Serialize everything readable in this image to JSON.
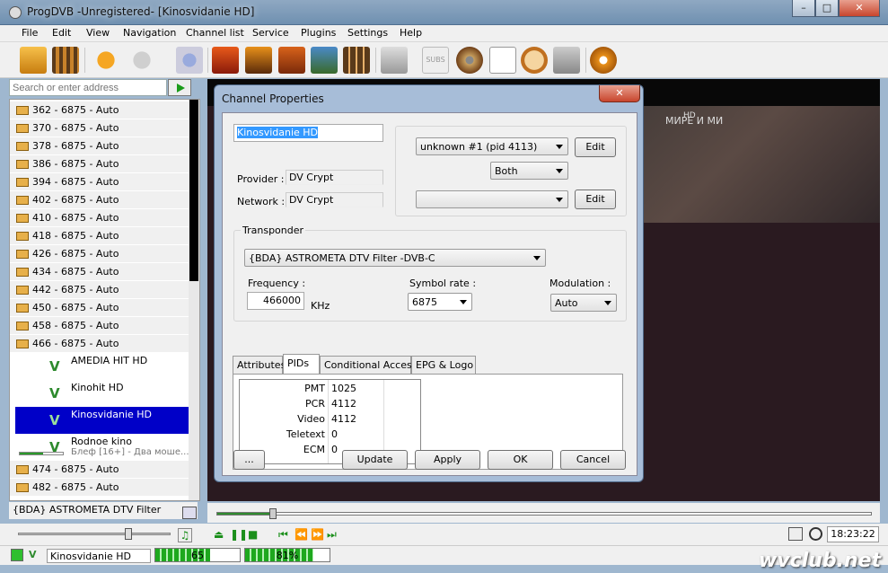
{
  "window": {
    "title": "ProgDVB -Unregistered-  [Kinosvidanie HD]",
    "controls": [
      "–",
      "□",
      "✕"
    ]
  },
  "menu": [
    "File",
    "Edit",
    "View",
    "Navigation",
    "Channel list",
    "Service",
    "Plugins",
    "Settings",
    "Help"
  ],
  "toolbar": {
    "icons": [
      "folder-open-icon",
      "film-icon",
      "back-arrow-icon",
      "forward-arrow-icon",
      "scan-icon",
      "monitor-icon",
      "monitor-pip-icon",
      "3d-icon",
      "picture-icon",
      "grid-icon",
      "record-icon",
      "subs-icon",
      "disc-icon",
      "notes-icon",
      "timer-icon",
      "window-icon",
      "gear-icon"
    ],
    "subs_label": "SUBS"
  },
  "address": {
    "placeholder": "Search or enter address"
  },
  "channel_list": {
    "groups_top": [
      "362 - 6875 - Auto",
      "370 - 6875 - Auto",
      "378 - 6875 - Auto",
      "386 - 6875 - Auto",
      "394 - 6875 - Auto",
      "402 - 6875 - Auto",
      "410 - 6875 - Auto",
      "418 - 6875 - Auto",
      "426 - 6875 - Auto",
      "434 - 6875 - Auto",
      "442 - 6875 - Auto",
      "450 - 6875 - Auto",
      "458 - 6875 - Auto",
      "466 - 6875 - Auto"
    ],
    "channels": [
      {
        "name": "AMEDIA HIT HD",
        "sub": ""
      },
      {
        "name": "Kinohit HD",
        "sub": ""
      },
      {
        "name": "Kinosvidanie HD",
        "sub": "",
        "selected": true
      },
      {
        "name": "Rodnoe kino",
        "sub": "Блеф [16+] - Два моше...",
        "progress": 0.55
      }
    ],
    "groups_bottom": [
      "474 - 6875 - Auto",
      "482 - 6875 - Auto"
    ],
    "device": "{BDA} ASTROMETA DTV Filter"
  },
  "video": {
    "overlay": "МИРЕ И МИ",
    "badge": "HD"
  },
  "dialog": {
    "title": "Channel Properties",
    "close": "✕",
    "name_value": "Kinosvidanie HD",
    "provider_label": "Provider :",
    "provider_value": "DV Crypt",
    "network_label": "Network :",
    "network_value": "DV Crypt",
    "audio_combo": "unknown #1 (pid 4113)",
    "channels_combo": "Both",
    "second_combo": "",
    "edit1": "Edit",
    "edit2": "Edit",
    "transponder_label": "Transponder",
    "transponder_combo": "{BDA} ASTROMETA DTV Filter -DVB-C",
    "frequency_label": "Frequency :",
    "frequency_value": "466000",
    "frequency_unit": "KHz",
    "symbol_label": "Symbol rate :",
    "symbol_value": "6875",
    "modulation_label": "Modulation :",
    "modulation_value": "Auto",
    "tabs": [
      "Attributes",
      "PIDs",
      "Conditional Access",
      "EPG & Logo"
    ],
    "active_tab": "PIDs",
    "pids": [
      {
        "k": "PMT",
        "v": "1025"
      },
      {
        "k": "PCR",
        "v": "4112"
      },
      {
        "k": "Video",
        "v": "4112"
      },
      {
        "k": "Teletext",
        "v": "0"
      },
      {
        "k": "ECM",
        "v": "0"
      }
    ],
    "buttons": {
      "more": "...",
      "update": "Update",
      "apply": "Apply",
      "ok": "OK",
      "cancel": "Cancel"
    }
  },
  "player": {
    "seek_position": 0.08,
    "volume": 0.7,
    "time": "18:23:22"
  },
  "status": {
    "channel": "Kinosvidanie HD",
    "signal_level": "65",
    "signal_level_value": 0.65,
    "signal_quality": "81%",
    "signal_quality_value": 0.81
  },
  "watermark": "wvclub.net",
  "colors": {
    "selection": "#0000c8",
    "accent_green": "#1ea81e"
  }
}
